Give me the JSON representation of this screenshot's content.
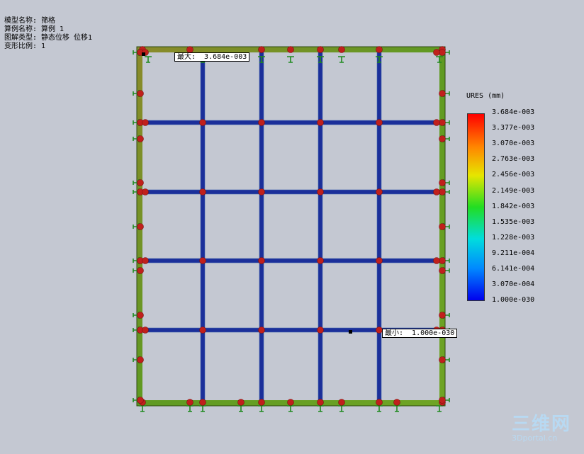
{
  "info": {
    "model_name": "模型名称: 筛格",
    "study_name": "算例名称: 算例 1",
    "plot_type": "图解类型: 静态位移 位移1",
    "deform_scale": "变形比例: 1"
  },
  "legend": {
    "title": "URES (mm)",
    "ticks": [
      "3.684e-003",
      "3.377e-003",
      "3.070e-003",
      "2.763e-003",
      "2.456e-003",
      "2.149e-003",
      "1.842e-003",
      "1.535e-003",
      "1.228e-003",
      "9.211e-004",
      "6.141e-004",
      "3.070e-004",
      "1.000e-030"
    ]
  },
  "max_tag": "最大:  3.684e-003",
  "min_tag": "最小:  1.000e-030",
  "watermark": {
    "brand": "三维网",
    "url": "3Dportal.cn"
  },
  "colors": {
    "frame_green": "#6b9a1c",
    "inner_blue": "#1b2f9a",
    "marker_red": "#c0201c",
    "fixture_green": "#1f8a1f"
  }
}
